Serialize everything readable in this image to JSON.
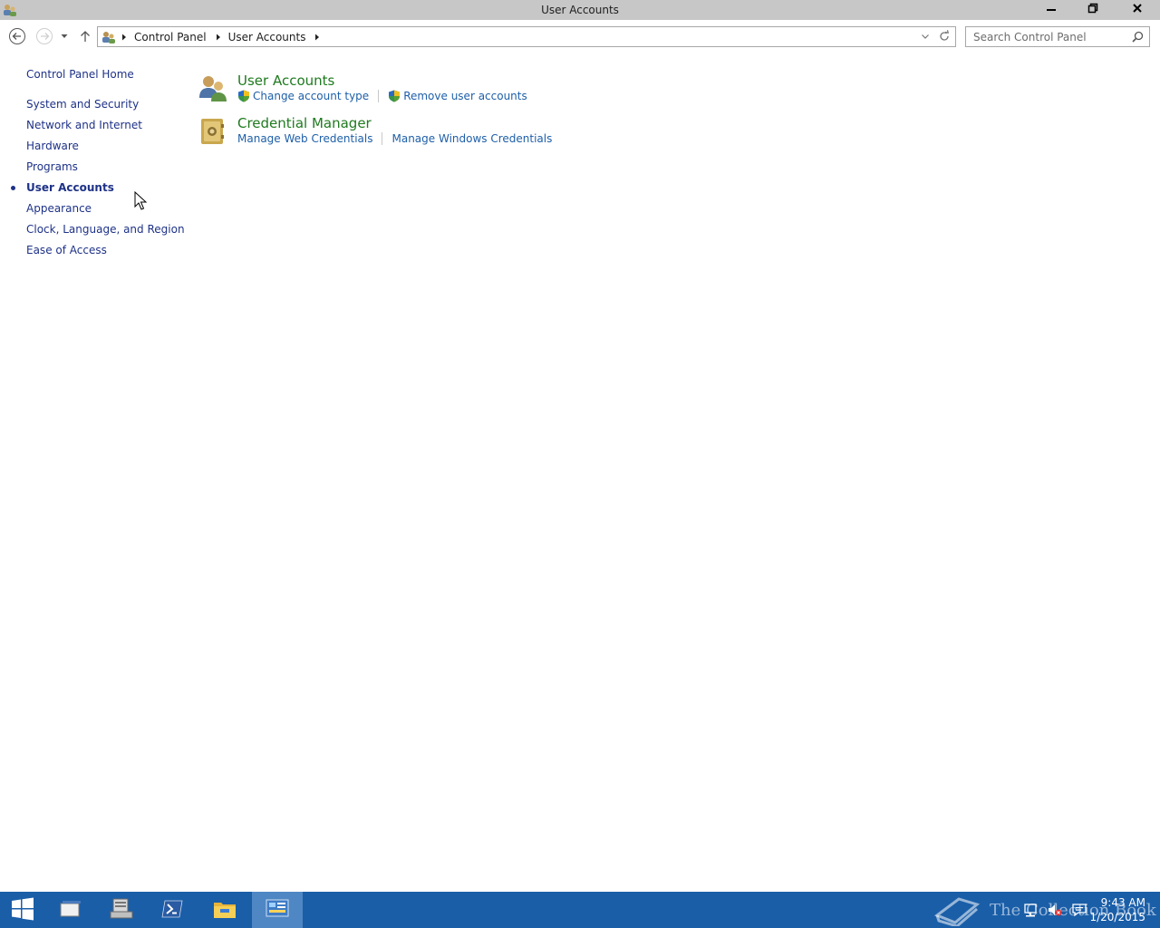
{
  "window": {
    "title": "User Accounts",
    "minimize_icon": "minimize-icon",
    "maximize_icon": "restore-icon",
    "close_icon": "close-icon"
  },
  "navigation": {
    "back_icon": "back-arrow-icon",
    "forward_icon": "forward-arrow-icon",
    "recent_icon": "chevron-down-icon",
    "up_icon": "up-arrow-icon",
    "breadcrumb": [
      "Control Panel",
      "User Accounts"
    ],
    "search_placeholder": "Search Control Panel"
  },
  "sidebar": {
    "home_label": "Control Panel Home",
    "items": [
      {
        "label": "System and Security",
        "current": false
      },
      {
        "label": "Network and Internet",
        "current": false
      },
      {
        "label": "Hardware",
        "current": false
      },
      {
        "label": "Programs",
        "current": false
      },
      {
        "label": "User Accounts",
        "current": true
      },
      {
        "label": "Appearance",
        "current": false
      },
      {
        "label": "Clock, Language, and Region",
        "current": false
      },
      {
        "label": "Ease of Access",
        "current": false
      }
    ]
  },
  "main": {
    "sections": [
      {
        "title": "User Accounts",
        "icon": "users-icon",
        "links": [
          {
            "label": "Change account type",
            "shield": true
          },
          {
            "label": "Remove user accounts",
            "shield": true
          }
        ]
      },
      {
        "title": "Credential Manager",
        "icon": "vault-icon",
        "links": [
          {
            "label": "Manage Web Credentials",
            "shield": false
          },
          {
            "label": "Manage Windows Credentials",
            "shield": false
          }
        ]
      }
    ]
  },
  "taskbar": {
    "items": [
      "start-icon",
      "task-view-icon",
      "server-manager-icon",
      "powershell-icon",
      "file-explorer-icon",
      "control-panel-icon"
    ],
    "watermark": "The Collection Book",
    "time": "9:43 AM",
    "date": "1/20/2015"
  },
  "colors": {
    "titlebar": "#c7c7c7",
    "taskbar": "#1a5ea8",
    "link": "#1e5fa8",
    "heading": "#1e7a1e",
    "nav_link": "#1e3287"
  }
}
